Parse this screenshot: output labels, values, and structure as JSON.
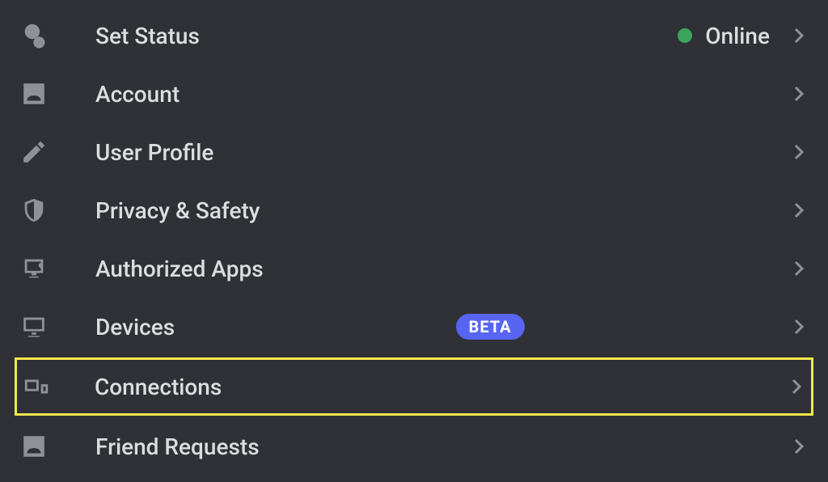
{
  "settings": {
    "items": [
      {
        "label": "Set Status",
        "status_text": "Online"
      },
      {
        "label": "Account"
      },
      {
        "label": "User Profile"
      },
      {
        "label": "Privacy & Safety"
      },
      {
        "label": "Authorized Apps"
      },
      {
        "label": "Devices",
        "badge": "BETA"
      },
      {
        "label": "Connections"
      },
      {
        "label": "Friend Requests"
      }
    ]
  },
  "status_color": "#3ba55c",
  "badge_color": "#5865f2",
  "highlight_color": "#f1e84b"
}
